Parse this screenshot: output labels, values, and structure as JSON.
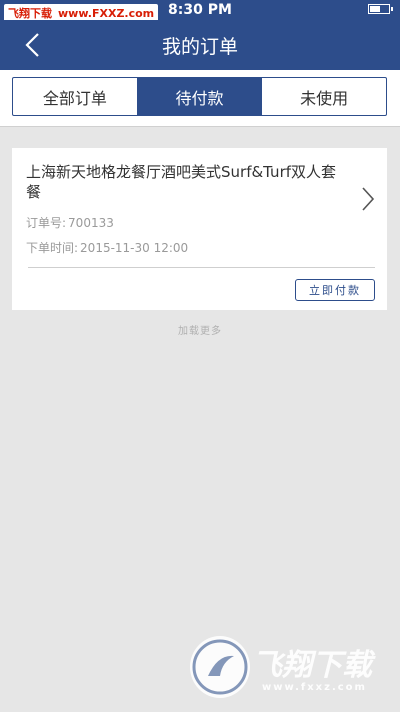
{
  "status_bar": {
    "time": "8:30 PM",
    "battery_level": 0.6,
    "watermark_brand": "飞翔下载",
    "watermark_site": "www.FXXZ.com"
  },
  "nav": {
    "title": "我的订单",
    "back_icon": "chevron-left-icon"
  },
  "tabs": [
    {
      "label": "全部订单",
      "active": false
    },
    {
      "label": "待付款",
      "active": true
    },
    {
      "label": "未使用",
      "active": false
    }
  ],
  "order": {
    "title": "上海新天地格龙餐厅酒吧美式Surf&Turf双人套餐",
    "order_no_label": "订单号:",
    "order_no": "700133",
    "time_label": "下单时间:",
    "time": "2015-11-30 12:00",
    "pay_button": "立即付款",
    "chevron_icon": "chevron-right-icon"
  },
  "load_more": "加载更多",
  "watermark": {
    "text": "飞翔下载",
    "url": "www.fxxz.com"
  },
  "colors": {
    "primary": "#2d4d8b",
    "background": "#e6e6e6"
  }
}
